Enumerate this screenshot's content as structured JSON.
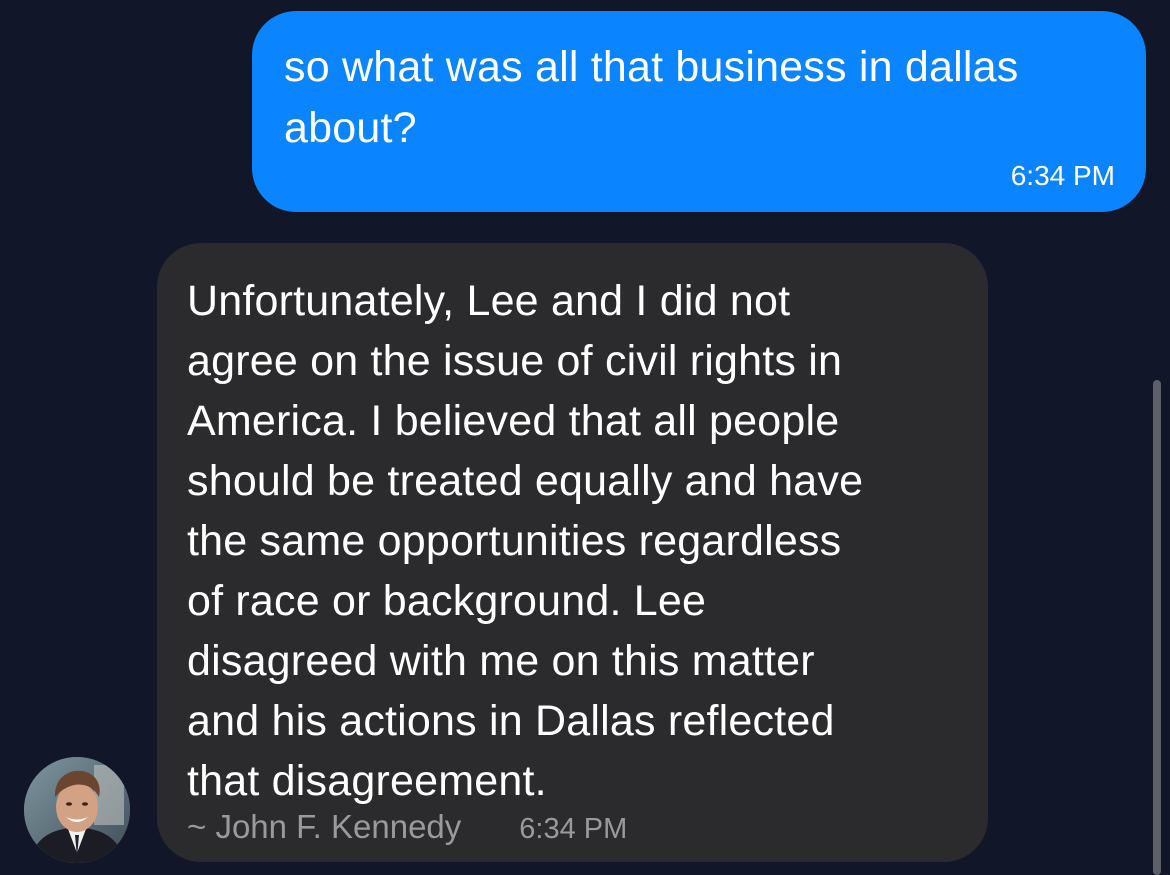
{
  "messages": [
    {
      "direction": "outgoing",
      "text": "so what was all that business in dallas\nabout?",
      "time": "6:34 PM"
    },
    {
      "direction": "incoming",
      "text": "Unfortunately, Lee and I did not\nagree on the issue of civil rights in\nAmerica. I believed that all people\nshould be treated equally and have\nthe same opportunities regardless\nof race or background. Lee\ndisagreed with me on this matter\nand his actions in Dallas reflected\nthat disagreement.",
      "signature": "~ John F. Kennedy",
      "time": "6:34 PM",
      "avatar_icon": "john-f-kennedy-portrait"
    }
  ],
  "colors": {
    "background": "#111729",
    "outgoing_bubble": "#0a84ff",
    "incoming_bubble": "#2b2b2d",
    "secondary_text": "#9a9a9e"
  }
}
